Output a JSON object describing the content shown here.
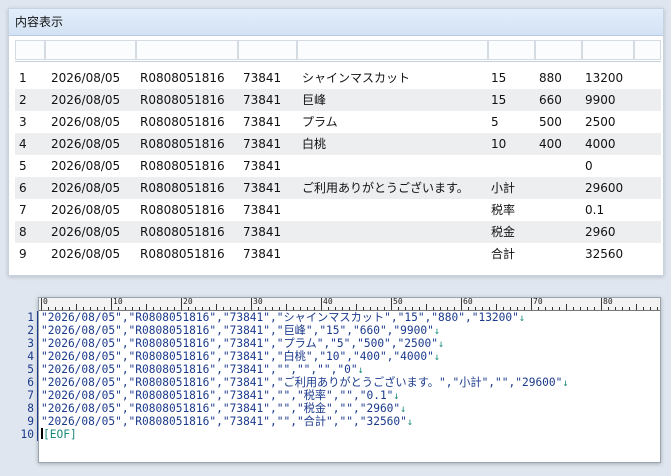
{
  "window": {
    "title": "内容表示"
  },
  "grid": {
    "rows": [
      {
        "n": "1",
        "date": "2026/08/05",
        "code": "R0808051816",
        "id": "73841",
        "item": "シャインマスカット",
        "qty": "15",
        "price": "880",
        "amount": "13200"
      },
      {
        "n": "2",
        "date": "2026/08/05",
        "code": "R0808051816",
        "id": "73841",
        "item": "巨峰",
        "qty": "15",
        "price": "660",
        "amount": "9900"
      },
      {
        "n": "3",
        "date": "2026/08/05",
        "code": "R0808051816",
        "id": "73841",
        "item": "プラム",
        "qty": "5",
        "price": "500",
        "amount": "2500"
      },
      {
        "n": "4",
        "date": "2026/08/05",
        "code": "R0808051816",
        "id": "73841",
        "item": "白桃",
        "qty": "10",
        "price": "400",
        "amount": "4000"
      },
      {
        "n": "5",
        "date": "2026/08/05",
        "code": "R0808051816",
        "id": "73841",
        "item": "",
        "qty": "",
        "price": "",
        "amount": "0"
      },
      {
        "n": "6",
        "date": "2026/08/05",
        "code": "R0808051816",
        "id": "73841",
        "item": "ご利用ありがとうございます。",
        "qty": "小計",
        "price": "",
        "amount": "29600"
      },
      {
        "n": "7",
        "date": "2026/08/05",
        "code": "R0808051816",
        "id": "73841",
        "item": "",
        "qty": "税率",
        "price": "",
        "amount": "0.1"
      },
      {
        "n": "8",
        "date": "2026/08/05",
        "code": "R0808051816",
        "id": "73841",
        "item": "",
        "qty": "税金",
        "price": "",
        "amount": "2960"
      },
      {
        "n": "9",
        "date": "2026/08/05",
        "code": "R0808051816",
        "id": "73841",
        "item": "",
        "qty": "合計",
        "price": "",
        "amount": "32560"
      }
    ]
  },
  "editor": {
    "ruler_marks": [
      "0",
      "10",
      "20",
      "30",
      "40",
      "50",
      "60",
      "70",
      "80"
    ],
    "line_numbers": [
      "1",
      "2",
      "3",
      "4",
      "5",
      "6",
      "7",
      "8",
      "9",
      "10"
    ],
    "lines": [
      "\"2026/08/05\",\"R0808051816\",\"73841\",\"シャインマスカット\",\"15\",\"880\",\"13200\"",
      "\"2026/08/05\",\"R0808051816\",\"73841\",\"巨峰\",\"15\",\"660\",\"9900\"",
      "\"2026/08/05\",\"R0808051816\",\"73841\",\"プラム\",\"5\",\"500\",\"2500\"",
      "\"2026/08/05\",\"R0808051816\",\"73841\",\"白桃\",\"10\",\"400\",\"4000\"",
      "\"2026/08/05\",\"R0808051816\",\"73841\",\"\",\"\",\"\",\"0\"",
      "\"2026/08/05\",\"R0808051816\",\"73841\",\"ご利用ありがとうございます。\",\"小計\",\"\",\"29600\"",
      "\"2026/08/05\",\"R0808051816\",\"73841\",\"\",\"税率\",\"\",\"0.1\"",
      "\"2026/08/05\",\"R0808051816\",\"73841\",\"\",\"税金\",\"\",\"2960\"",
      "\"2026/08/05\",\"R0808051816\",\"73841\",\"\",\"合計\",\"\",\"32560\""
    ],
    "eol_mark": "↓",
    "eof_mark": "[EOF]"
  },
  "colors": {
    "text_blue": "#1b3a8c",
    "eol_teal": "#1a8a7c",
    "title_bar": "#dbe8f7"
  }
}
